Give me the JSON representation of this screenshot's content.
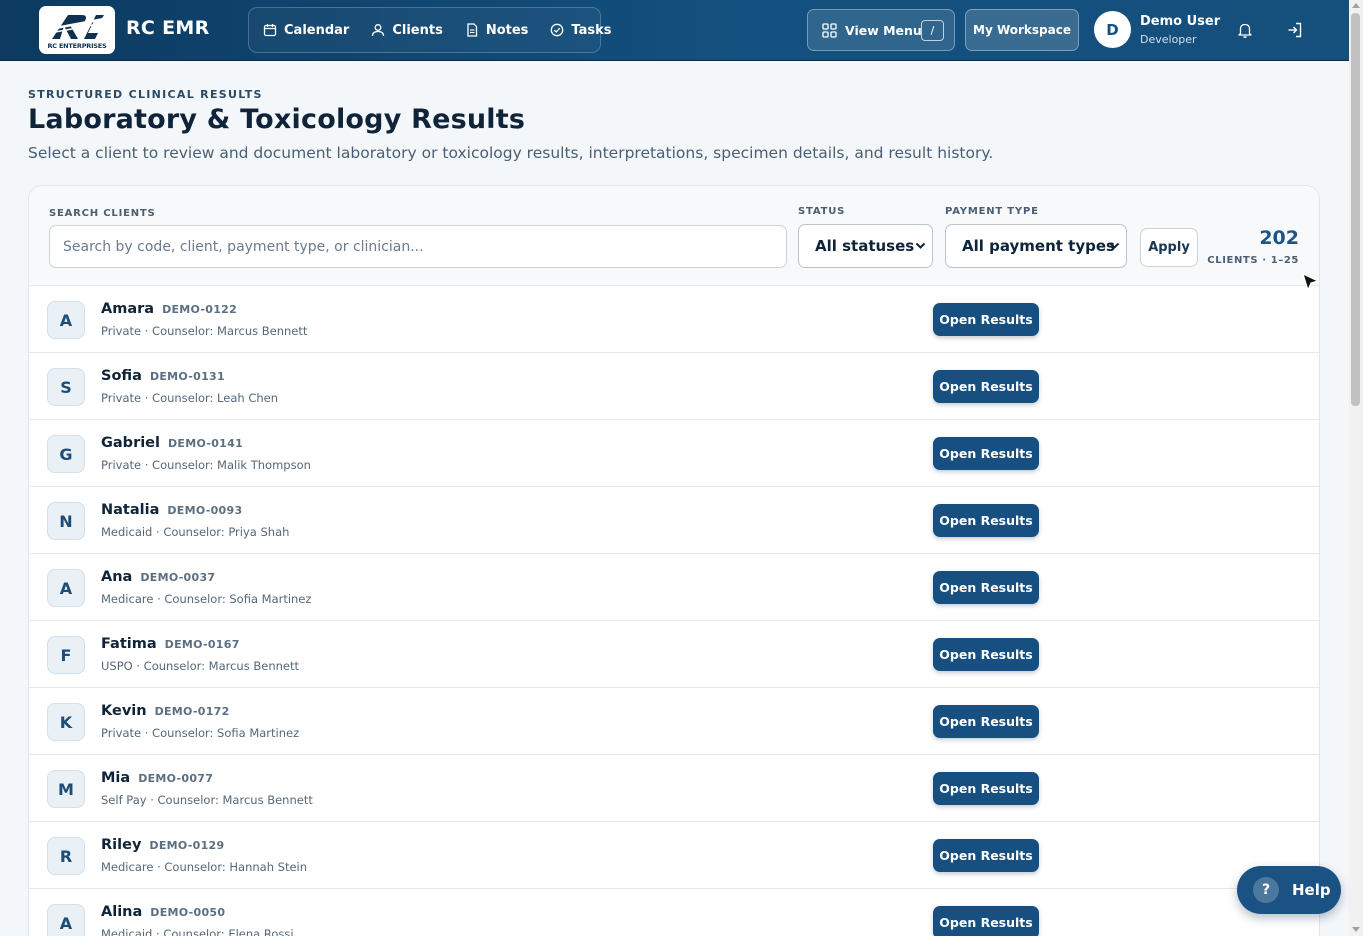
{
  "app": {
    "logo_text": "RC ENTERPRISES",
    "brand": "RC EMR"
  },
  "nav": {
    "items": [
      {
        "label": "Calendar",
        "icon": "calendar-icon"
      },
      {
        "label": "Clients",
        "icon": "user-icon"
      },
      {
        "label": "Notes",
        "icon": "document-icon"
      },
      {
        "label": "Tasks",
        "icon": "check-circle-icon"
      }
    ],
    "view_menu": "View Menu",
    "view_menu_shortcut": "/",
    "workspace": "My Workspace"
  },
  "user": {
    "initial": "D",
    "name": "Demo User",
    "role": "Developer"
  },
  "header": {
    "eyebrow": "STRUCTURED CLINICAL RESULTS",
    "title": "Laboratory & Toxicology Results",
    "subtitle": "Select a client to review and document laboratory or toxicology results, interpretations, specimen details, and result history."
  },
  "filters": {
    "search_label": "SEARCH CLIENTS",
    "search_placeholder": "Search by code, client, payment type, or clinician...",
    "search_value": "",
    "status_label": "STATUS",
    "status_value": "All statuses",
    "payment_label": "PAYMENT TYPE",
    "payment_value": "All payment types",
    "apply": "Apply",
    "count": "202",
    "count_label": "CLIENTS · 1–25"
  },
  "clients": [
    {
      "initial": "A",
      "name": "Amara",
      "code": "DEMO-0122",
      "meta": "Private · Counselor: Marcus Bennett",
      "action": "Open Results"
    },
    {
      "initial": "S",
      "name": "Sofia",
      "code": "DEMO-0131",
      "meta": "Private · Counselor: Leah Chen",
      "action": "Open Results"
    },
    {
      "initial": "G",
      "name": "Gabriel",
      "code": "DEMO-0141",
      "meta": "Private · Counselor: Malik Thompson",
      "action": "Open Results"
    },
    {
      "initial": "N",
      "name": "Natalia",
      "code": "DEMO-0093",
      "meta": "Medicaid · Counselor: Priya Shah",
      "action": "Open Results"
    },
    {
      "initial": "A",
      "name": "Ana",
      "code": "DEMO-0037",
      "meta": "Medicare · Counselor: Sofia Martinez",
      "action": "Open Results"
    },
    {
      "initial": "F",
      "name": "Fatima",
      "code": "DEMO-0167",
      "meta": "USPO · Counselor: Marcus Bennett",
      "action": "Open Results"
    },
    {
      "initial": "K",
      "name": "Kevin",
      "code": "DEMO-0172",
      "meta": "Private · Counselor: Sofia Martinez",
      "action": "Open Results"
    },
    {
      "initial": "M",
      "name": "Mia",
      "code": "DEMO-0077",
      "meta": "Self Pay · Counselor: Marcus Bennett",
      "action": "Open Results"
    },
    {
      "initial": "R",
      "name": "Riley",
      "code": "DEMO-0129",
      "meta": "Medicare · Counselor: Hannah Stein",
      "action": "Open Results"
    },
    {
      "initial": "A",
      "name": "Alina",
      "code": "DEMO-0050",
      "meta": "Medicaid · Counselor: Elena Rossi",
      "action": "Open Results"
    }
  ],
  "help": {
    "icon": "?",
    "label": "Help"
  },
  "colors": {
    "nav_bg": "#14507f",
    "primary_button": "#164f80",
    "accent_count": "#1e5585"
  }
}
